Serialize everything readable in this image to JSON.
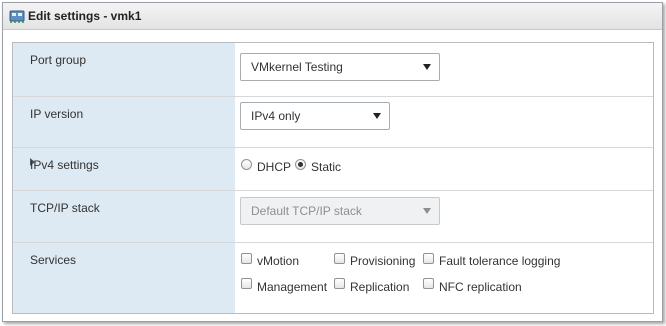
{
  "dialog": {
    "title": "Edit settings - vmk1"
  },
  "port_group": {
    "label": "Port group",
    "selected": "VMkernel Testing"
  },
  "ip_version": {
    "label": "IP version",
    "selected": "IPv4 only"
  },
  "ipv4_settings": {
    "label": "IPv4 settings",
    "options": [
      {
        "label": "DHCP",
        "selected": false
      },
      {
        "label": "Static",
        "selected": true
      }
    ]
  },
  "tcpip_stack": {
    "label": "TCP/IP stack",
    "selected": "Default TCP/IP stack",
    "disabled": true
  },
  "services": {
    "label": "Services",
    "items": [
      {
        "label": "vMotion",
        "checked": false
      },
      {
        "label": "Provisioning",
        "checked": false
      },
      {
        "label": "Fault tolerance logging",
        "checked": false
      },
      {
        "label": "Management",
        "checked": false
      },
      {
        "label": "Replication",
        "checked": false
      },
      {
        "label": "NFC replication",
        "checked": false
      }
    ]
  },
  "colors": {
    "label_bg": "#dde9f3",
    "border": "#d6d9dc"
  },
  "icons": {
    "title": "network-adapter-icon",
    "expand": "triangle-right-icon"
  }
}
